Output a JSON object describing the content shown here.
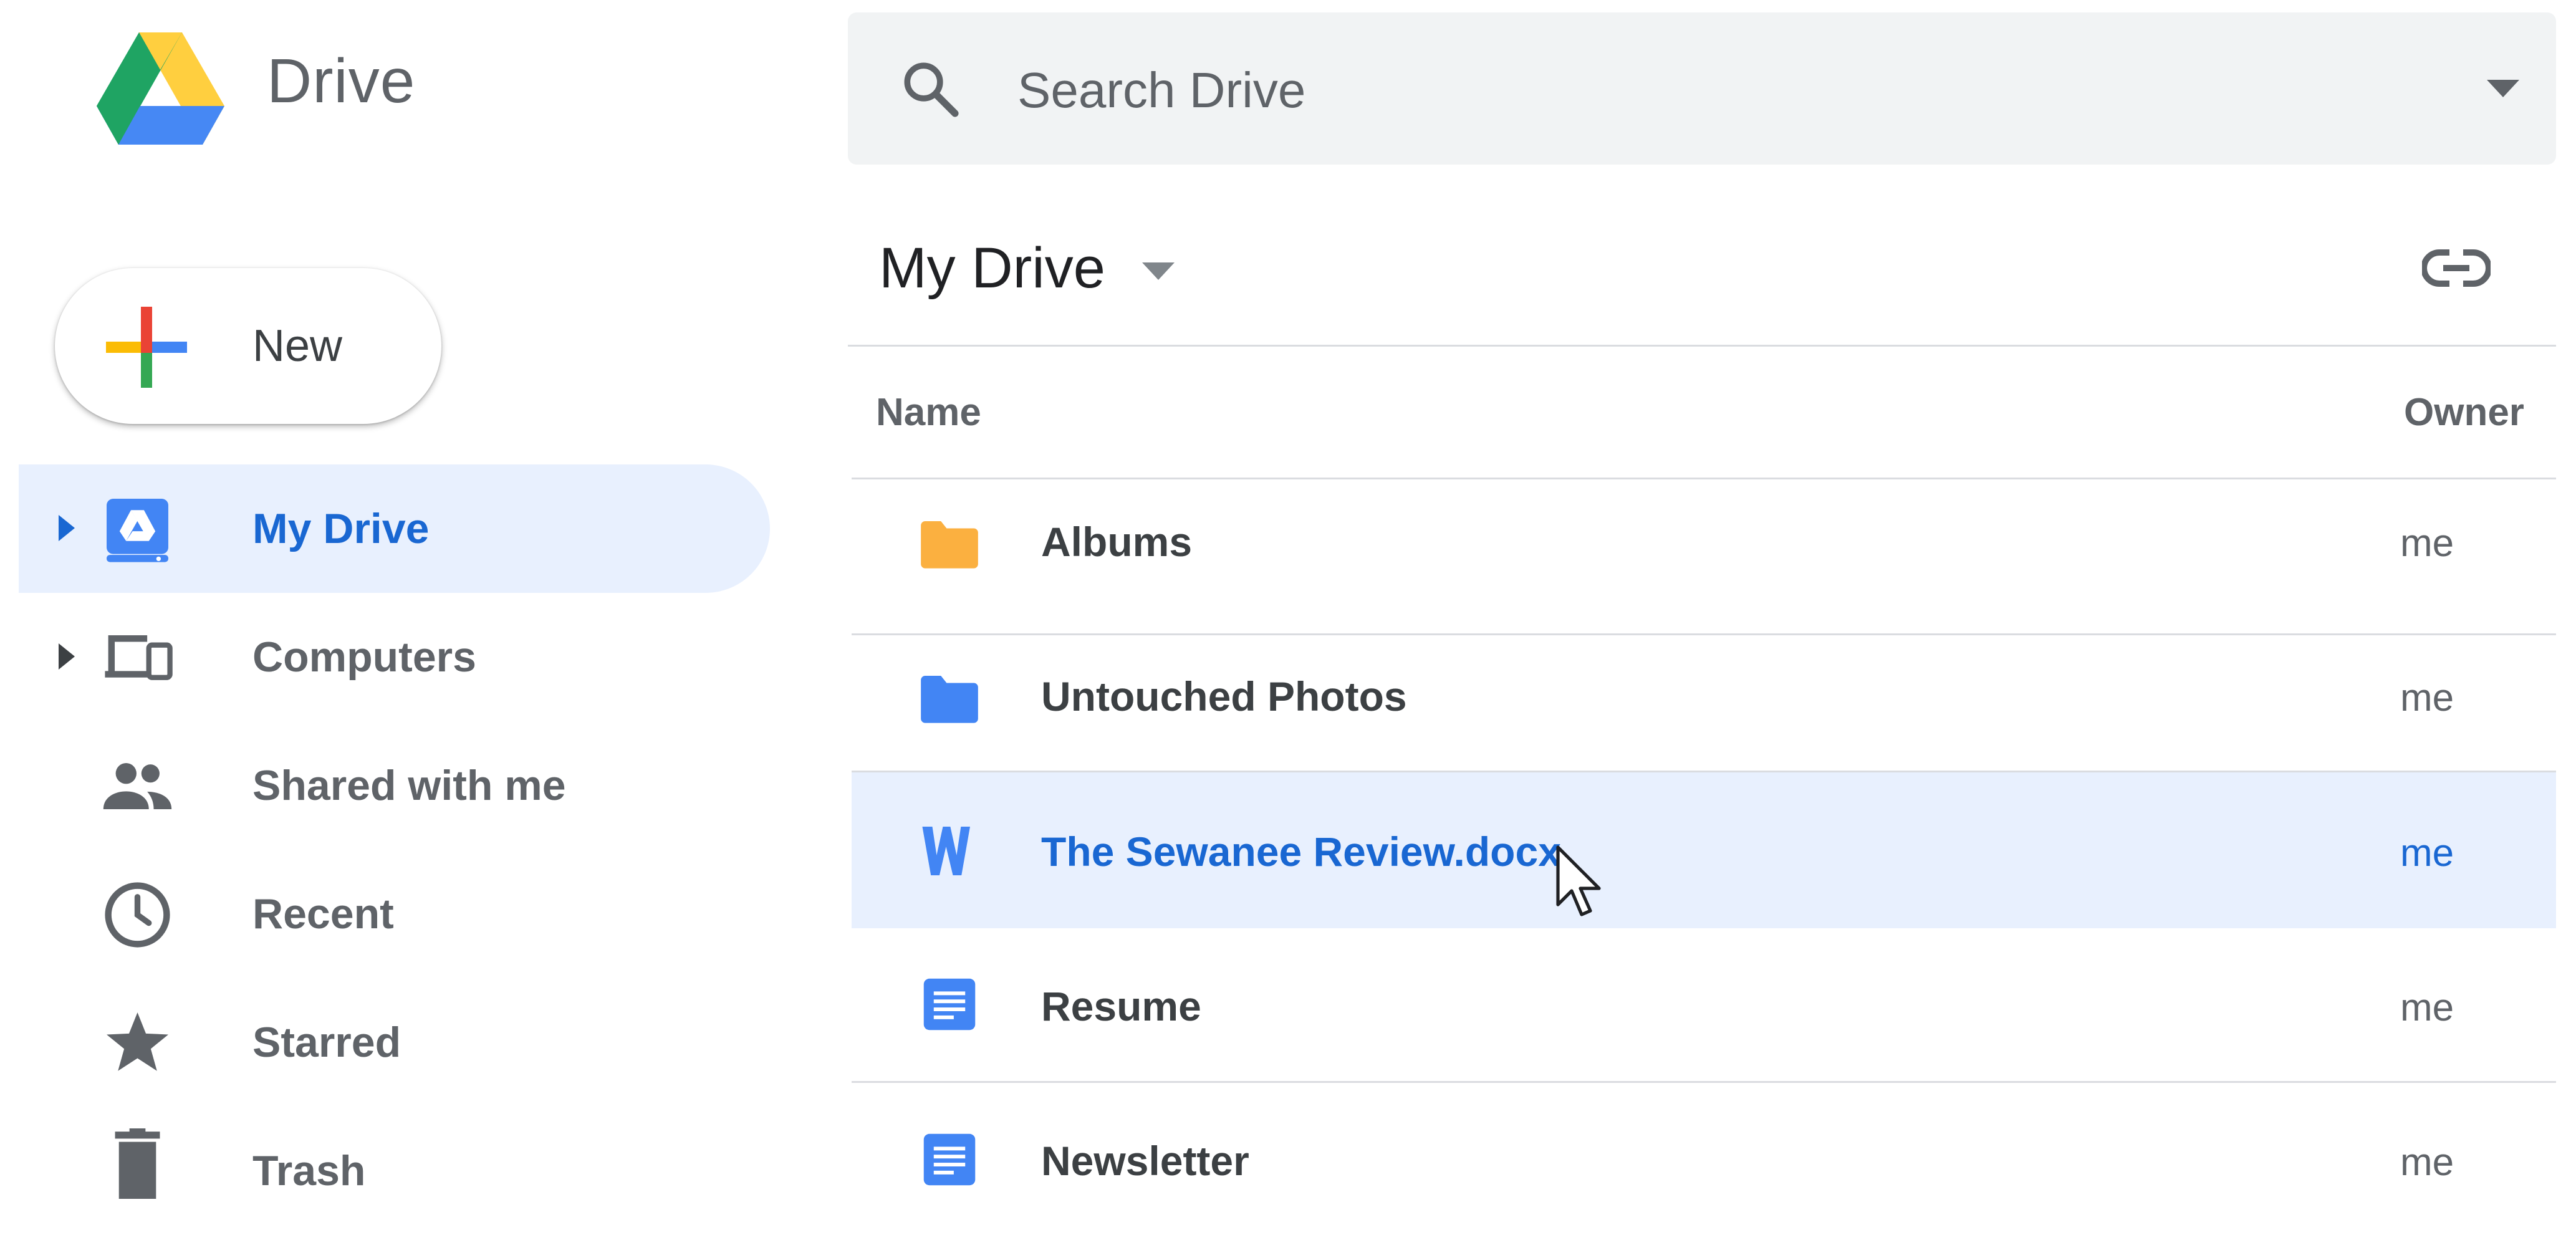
{
  "app": {
    "title": "Drive",
    "logo_icon": "drive-logo-icon"
  },
  "search": {
    "placeholder": "Search Drive",
    "icon": "search-icon",
    "options_icon": "caret-down-icon"
  },
  "new_button": {
    "label": "New",
    "icon": "colorful-plus-icon"
  },
  "sidebar": {
    "items": [
      {
        "label": "My Drive",
        "icon": "my-drive-icon",
        "expandable": true,
        "active": true
      },
      {
        "label": "Computers",
        "icon": "computers-icon",
        "expandable": true,
        "active": false
      },
      {
        "label": "Shared with me",
        "icon": "people-icon",
        "expandable": false,
        "active": false
      },
      {
        "label": "Recent",
        "icon": "clock-icon",
        "expandable": false,
        "active": false
      },
      {
        "label": "Starred",
        "icon": "star-icon",
        "expandable": false,
        "active": false
      },
      {
        "label": "Trash",
        "icon": "trash-icon",
        "expandable": false,
        "active": false
      }
    ]
  },
  "main": {
    "title": "My Drive",
    "title_dropdown_icon": "caret-down-icon",
    "action_icon": "link-icon",
    "columns": {
      "name": "Name",
      "owner": "Owner"
    },
    "rows": [
      {
        "name": "Albums",
        "owner": "me",
        "icon": "folder-icon",
        "icon_color": "#fbb040",
        "selected": false
      },
      {
        "name": "Untouched Photos",
        "owner": "me",
        "icon": "folder-icon",
        "icon_color": "#4285f4",
        "selected": false
      },
      {
        "name": "The Sewanee Review.docx",
        "owner": "me",
        "icon": "word-doc-icon",
        "icon_color": "#4285f4",
        "selected": true
      },
      {
        "name": "Resume",
        "owner": "me",
        "icon": "google-doc-icon",
        "icon_color": "#4285f4",
        "selected": false
      },
      {
        "name": "Newsletter",
        "owner": "me",
        "icon": "google-doc-icon",
        "icon_color": "#4285f4",
        "selected": false
      }
    ]
  },
  "colors": {
    "accent": "#1967d2",
    "selection_bg": "#e8f0fe",
    "search_bg": "#f1f3f4",
    "text_primary": "#3c4043",
    "text_secondary": "#5f6368",
    "divider": "#dadce0"
  }
}
